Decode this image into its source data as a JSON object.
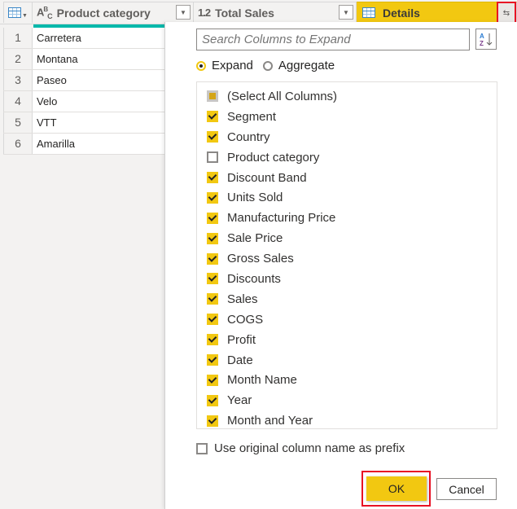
{
  "grid": {
    "columns": [
      {
        "type_icon": "ABC",
        "title": "Product category"
      },
      {
        "type_icon": "1.2",
        "title": "Total Sales"
      },
      {
        "type_icon": "table",
        "title": "Details"
      }
    ],
    "rows": [
      {
        "num": "1",
        "value": "Carretera"
      },
      {
        "num": "2",
        "value": "Montana"
      },
      {
        "num": "3",
        "value": "Paseo"
      },
      {
        "num": "4",
        "value": "Velo"
      },
      {
        "num": "5",
        "value": "VTT"
      },
      {
        "num": "6",
        "value": "Amarilla"
      }
    ],
    "accent_color": "#f2c811",
    "selection_color": "#01b8aa"
  },
  "popup": {
    "search_placeholder": "Search Columns to Expand",
    "radio_expand": "Expand",
    "radio_aggregate": "Aggregate",
    "selected_mode": "Expand",
    "items": [
      {
        "label": "(Select All Columns)",
        "state": "partial"
      },
      {
        "label": "Segment",
        "state": "checked"
      },
      {
        "label": "Country",
        "state": "checked"
      },
      {
        "label": "Product category",
        "state": "unchecked"
      },
      {
        "label": "Discount Band",
        "state": "checked"
      },
      {
        "label": "Units Sold",
        "state": "checked"
      },
      {
        "label": "Manufacturing Price",
        "state": "checked"
      },
      {
        "label": "Sale Price",
        "state": "checked"
      },
      {
        "label": "Gross Sales",
        "state": "checked"
      },
      {
        "label": "Discounts",
        "state": "checked"
      },
      {
        "label": "Sales",
        "state": "checked"
      },
      {
        "label": "COGS",
        "state": "checked"
      },
      {
        "label": "Profit",
        "state": "checked"
      },
      {
        "label": "Date",
        "state": "checked"
      },
      {
        "label": "Month Name",
        "state": "checked"
      },
      {
        "label": "Year",
        "state": "checked"
      },
      {
        "label": "Month and Year",
        "state": "checked"
      }
    ],
    "prefix_label": "Use original column name as prefix",
    "prefix_checked": false,
    "ok_label": "OK",
    "cancel_label": "Cancel"
  }
}
